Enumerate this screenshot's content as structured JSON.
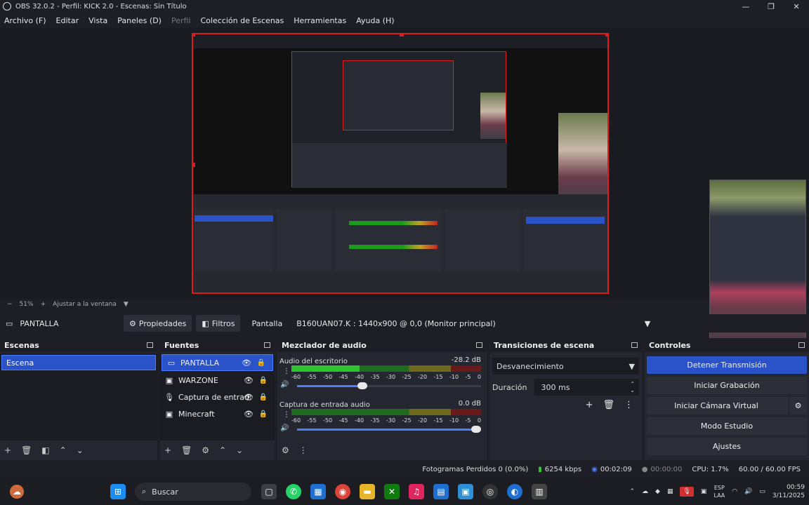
{
  "window": {
    "title": "OBS 32.0.2 - Perfil: KICK 2.0 - Escenas: Sin Título"
  },
  "menu": [
    "Archivo (F)",
    "Editar",
    "Vista",
    "Paneles (D)",
    "Perfil",
    "Colección de Escenas",
    "Herramientas",
    "Ayuda (H)"
  ],
  "zoom": {
    "percent": "51%",
    "fit_label": "Ajustar a la ventana"
  },
  "source_toolbar": {
    "source_name": "PANTALLA",
    "properties": "Propiedades",
    "filters": "Filtros",
    "display_label": "Pantalla",
    "display_value": "B160UAN07.K : 1440x900 @ 0,0 (Monitor principal)"
  },
  "scenes": {
    "title": "Escenas",
    "items": [
      "Escena"
    ]
  },
  "sources": {
    "title": "Fuentes",
    "items": [
      {
        "name": "PANTALLA",
        "icon": "monitor-icon"
      },
      {
        "name": "WARZONE",
        "icon": "window-icon"
      },
      {
        "name": "Captura de entrad:",
        "icon": "microphone-icon"
      },
      {
        "name": "Minecraft",
        "icon": "window-icon"
      }
    ]
  },
  "mixer": {
    "title": "Mezclador de audio",
    "ticks": [
      "-60",
      "-55",
      "-50",
      "-45",
      "-40",
      "-35",
      "-30",
      "-25",
      "-20",
      "-15",
      "-10",
      "-5",
      "0"
    ],
    "channels": [
      {
        "name": "Audio del escritorio",
        "db": "-28.2 dB",
        "level": 0.36,
        "volume": 0.38
      },
      {
        "name": "Captura de entrada audio",
        "db": "0.0 dB",
        "level": 0.0,
        "volume": 1.0
      }
    ]
  },
  "transitions": {
    "title": "Transiciones de escena",
    "selected": "Desvanecimiento",
    "duration_label": "Duración",
    "duration_value": "300 ms"
  },
  "controls": {
    "title": "Controles",
    "buttons": [
      "Detener Transmisión",
      "Iniciar Grabación",
      "Iniciar Cámara Virtual",
      "Modo Estudio",
      "Ajustes"
    ]
  },
  "status": {
    "dropped": "Fotogramas Perdidos 0 (0.0%)",
    "bitrate": "6254 kbps",
    "stream_time": "00:02:09",
    "rec_time": "00:00:00",
    "cpu": "CPU: 1.7%",
    "fps": "60.00 / 60.00 FPS"
  },
  "taskbar": {
    "search": "Buscar",
    "lang_top": "ESP",
    "lang_bottom": "LAA",
    "time": "00:59",
    "date": "3/11/2025"
  },
  "colors": {
    "accent": "#2a53c9",
    "selection_border": "#e01b1b",
    "background": "#1e1f26"
  }
}
